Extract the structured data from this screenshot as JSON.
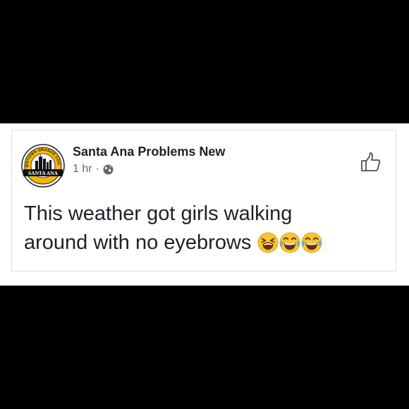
{
  "post": {
    "page_name": "Santa Ana Problems New",
    "time": "1 hr",
    "separator": "·",
    "privacy_icon": "globe-icon",
    "text_line1": "This weather got girls  walking",
    "text_line2": "around with no eyebrows",
    "emojis": [
      "tired-face-emoji",
      "tears-of-joy-emoji",
      "tears-of-joy-emoji"
    ],
    "like_icon": "thumbs-up-icon"
  },
  "avatar": {
    "top_text": "DOWNTOWN ORANGE COUNTY",
    "banner_text": "SANTA ANA"
  },
  "colors": {
    "background": "#000000",
    "card_border": "#dddfe2",
    "name_text": "#1d2129",
    "meta_text": "#606770",
    "avatar_gold": "#f2b705"
  }
}
